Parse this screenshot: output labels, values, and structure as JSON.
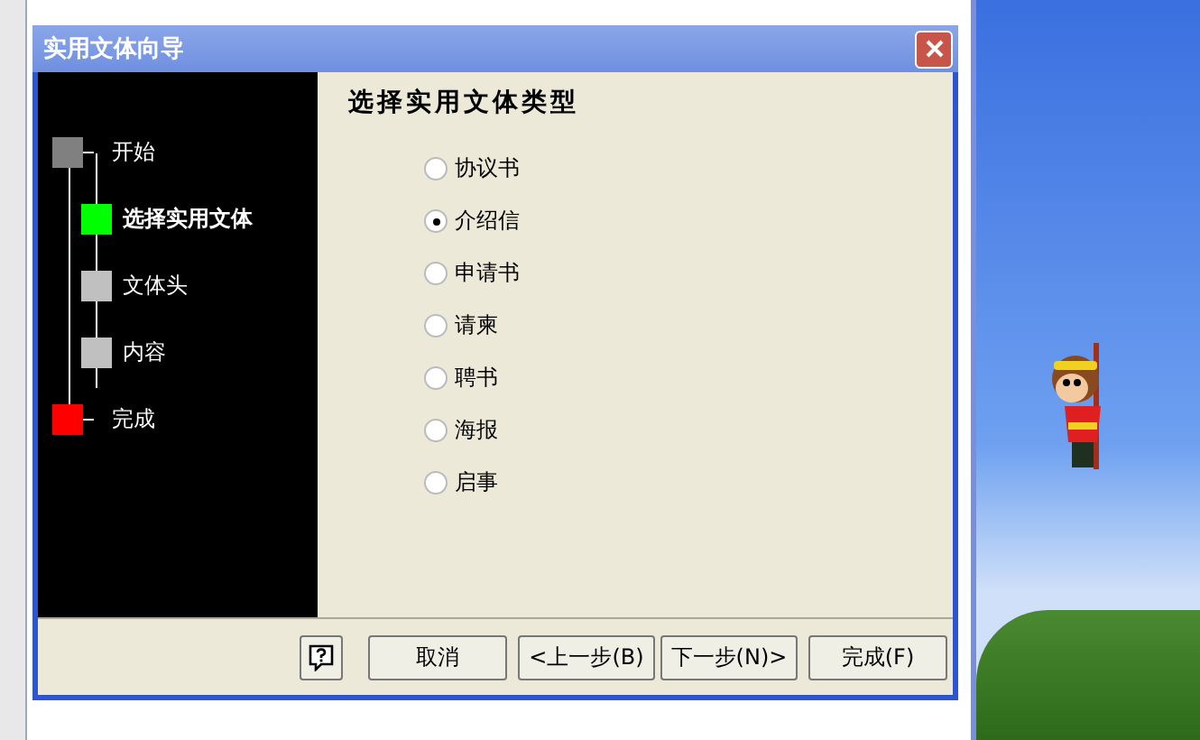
{
  "window": {
    "title": "实用文体向导"
  },
  "steps": [
    {
      "label": "开始",
      "color": "#808080",
      "selected": false,
      "children": [
        {
          "label": "选择实用文体",
          "color": "#00ff00",
          "selected": true
        },
        {
          "label": "文体头",
          "color": "#c0c0c0",
          "selected": false
        },
        {
          "label": "内容",
          "color": "#c0c0c0",
          "selected": false
        }
      ]
    },
    {
      "label": "完成",
      "color": "#ff0000",
      "selected": false
    }
  ],
  "heading": "选择实用文体类型",
  "options": [
    {
      "label": "协议书",
      "selected": false
    },
    {
      "label": "介绍信",
      "selected": true
    },
    {
      "label": "申请书",
      "selected": false
    },
    {
      "label": "请柬",
      "selected": false
    },
    {
      "label": "聘书",
      "selected": false
    },
    {
      "label": "海报",
      "selected": false
    },
    {
      "label": "启事",
      "selected": false
    }
  ],
  "buttons": [
    "取消",
    "<上一步(B)",
    "下一步(N)>",
    "完成(F)"
  ]
}
